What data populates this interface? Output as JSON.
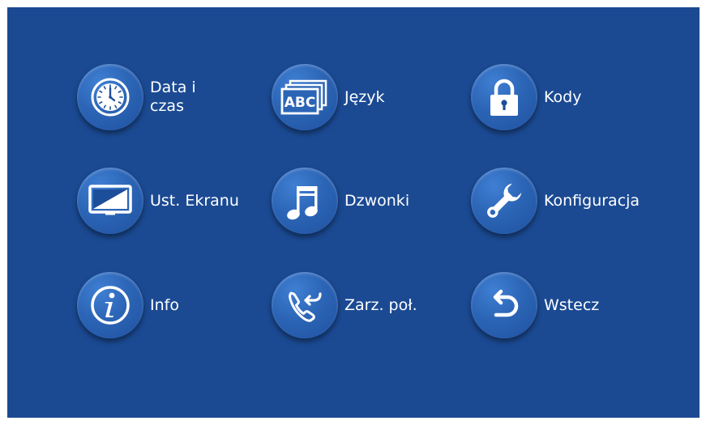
{
  "menu": {
    "items": [
      {
        "id": "date-time",
        "label": "Data i czas",
        "icon": "clock-icon"
      },
      {
        "id": "language",
        "label": "Język",
        "icon": "abc-icon"
      },
      {
        "id": "codes",
        "label": "Kody",
        "icon": "lock-icon"
      },
      {
        "id": "screen-settings",
        "label": "Ust. Ekranu",
        "icon": "monitor-icon"
      },
      {
        "id": "ringtones",
        "label": "Dzwonki",
        "icon": "music-note-icon"
      },
      {
        "id": "configuration",
        "label": "Konfiguracja",
        "icon": "wrench-icon"
      },
      {
        "id": "info",
        "label": "Info",
        "icon": "info-icon"
      },
      {
        "id": "call-management",
        "label": "Zarz. poł.",
        "icon": "incoming-call-icon"
      },
      {
        "id": "back",
        "label": "Wstecz",
        "icon": "back-arrow-icon"
      }
    ]
  },
  "colors": {
    "background": "#1b4a93",
    "button": "#2c65b6",
    "text": "#ffffff"
  }
}
